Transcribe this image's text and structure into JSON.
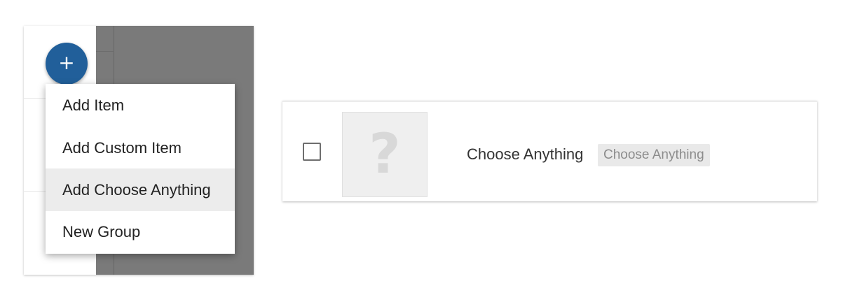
{
  "fab": {
    "icon": "plus-icon",
    "label": "+",
    "color": "#215f9a"
  },
  "menu": {
    "items": [
      {
        "label": "Add Item"
      },
      {
        "label": "Add Custom Item"
      },
      {
        "label": "Add Choose Anything",
        "highlighted": true
      },
      {
        "label": "New Group"
      }
    ]
  },
  "item_card": {
    "checkbox_checked": false,
    "thumbnail_icon": "question-mark-icon",
    "thumbnail_glyph": "?",
    "title": "Choose Anything",
    "tag": "Choose Anything"
  }
}
